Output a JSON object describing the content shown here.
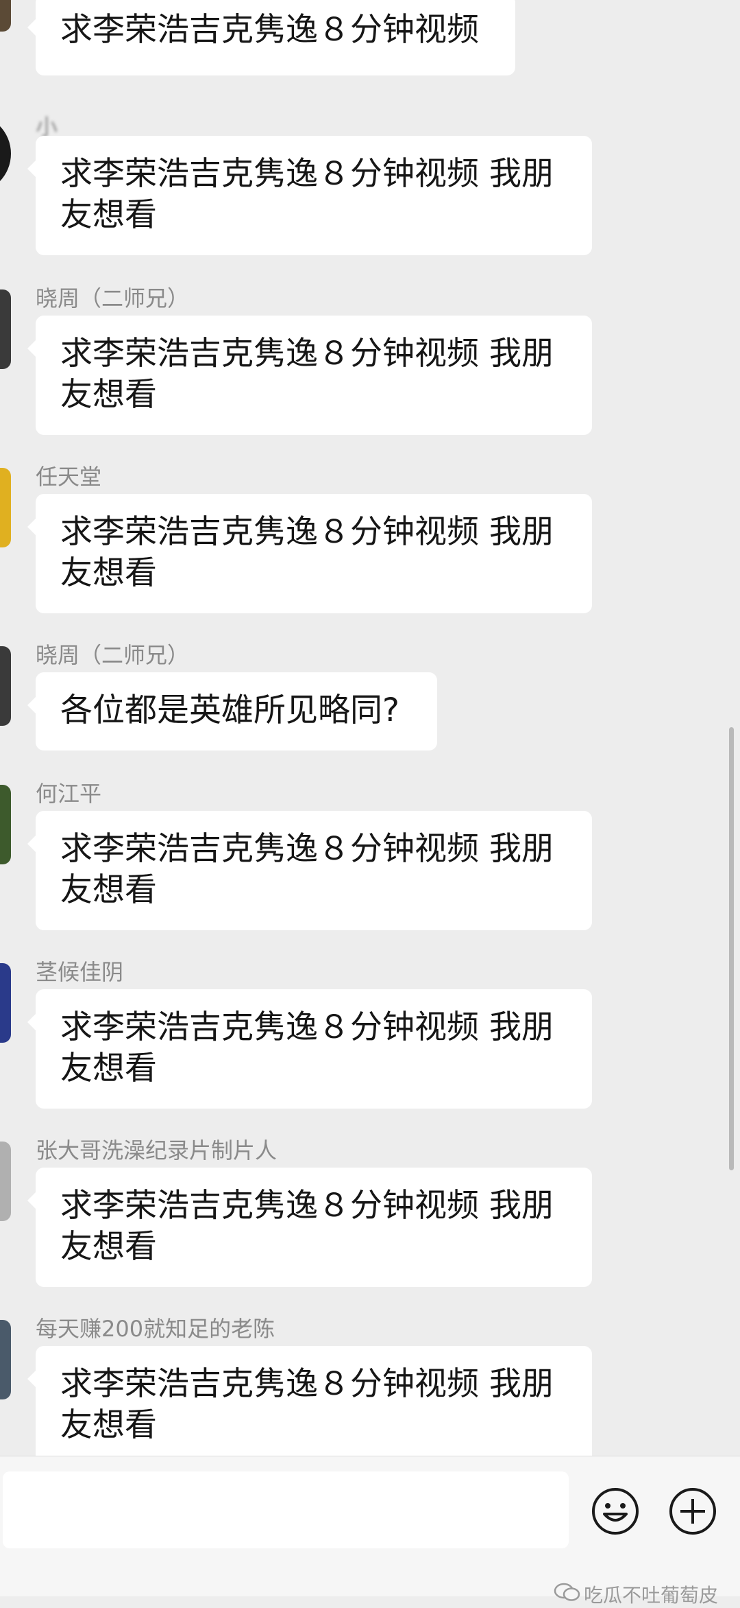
{
  "messages": [
    {
      "sender": "",
      "text": "求李荣浩吉克隽逸８分钟视频"
    },
    {
      "sender": "小  ",
      "text": "求李荣浩吉克隽逸８分钟视频 我朋友想看"
    },
    {
      "sender": "晓周（二师兄）",
      "text": "求李荣浩吉克隽逸８分钟视频 我朋友想看"
    },
    {
      "sender": "任天堂",
      "text": "求李荣浩吉克隽逸８分钟视频 我朋友想看"
    },
    {
      "sender": "晓周（二师兄）",
      "text": "各位都是英雄所见略同?"
    },
    {
      "sender": "何江平",
      "text": "求李荣浩吉克隽逸８分钟视频 我朋友想看"
    },
    {
      "sender": "茎候佳阴",
      "text": "求李荣浩吉克隽逸８分钟视频 我朋友想看"
    },
    {
      "sender": "张大哥洗澡纪录片制片人",
      "text": "求李荣浩吉克隽逸８分钟视频 我朋友想看"
    },
    {
      "sender": "每天赚200就知足的老陈",
      "text": "求李荣浩吉克隽逸８分钟视频 我朋友想看"
    }
  ],
  "input": {
    "emoji_icon": "emoji-icon",
    "plus_icon": "plus-icon"
  },
  "watermark": "吃瓜不吐葡萄皮",
  "colors": {
    "background": "#ededed",
    "bubble": "#ffffff",
    "sender_text": "#8a8a8a",
    "message_text": "#161616"
  }
}
